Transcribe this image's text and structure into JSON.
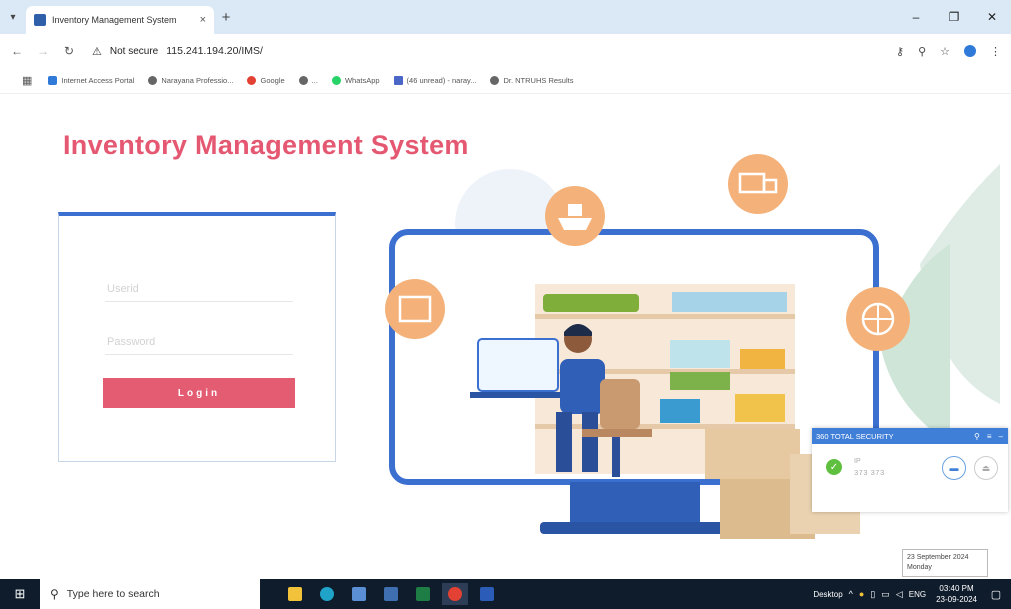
{
  "browser": {
    "tab_title": "Inventory Management System",
    "tab_close": "×",
    "new_tab": "+",
    "security_label": "Not secure",
    "url": "115.241.194.20/IMS/",
    "window_controls": {
      "minimize": "–",
      "maximize": "❐",
      "close": "✕"
    }
  },
  "bookmarks": [
    {
      "label": "Internet Access Portal",
      "color": "#2f7ad9"
    },
    {
      "label": "Narayana Professio...",
      "color": "#666666"
    },
    {
      "label": "Google",
      "color": "#e34133"
    },
    {
      "label": "...",
      "color": "#666666"
    },
    {
      "label": "WhatsApp",
      "color": "#25d366"
    },
    {
      "label": "(46 unread) - naray...",
      "color": "#4a67c8"
    },
    {
      "label": "Dr. NTRUHS Results",
      "color": "#666666"
    }
  ],
  "page": {
    "title": "Inventory Management System",
    "login": {
      "username_placeholder": "Userid",
      "password_placeholder": "Password",
      "button_label": "Login"
    }
  },
  "security_popup": {
    "title": "360 TOTAL SECURITY",
    "status_label": "IP",
    "status_value": "373 373"
  },
  "tooltip": {
    "date": "23 September 2024",
    "day": "Monday"
  },
  "taskbar": {
    "search_placeholder": "Type here to search",
    "desktop_label": "Desktop",
    "language": "ENG",
    "time": "03:40 PM",
    "date": "23-09-2024"
  },
  "colors": {
    "accent_pink": "#e55872",
    "login_button": "#e45c72",
    "frame_blue": "#3b6fd0",
    "badge_orange": "#f4b27a"
  }
}
